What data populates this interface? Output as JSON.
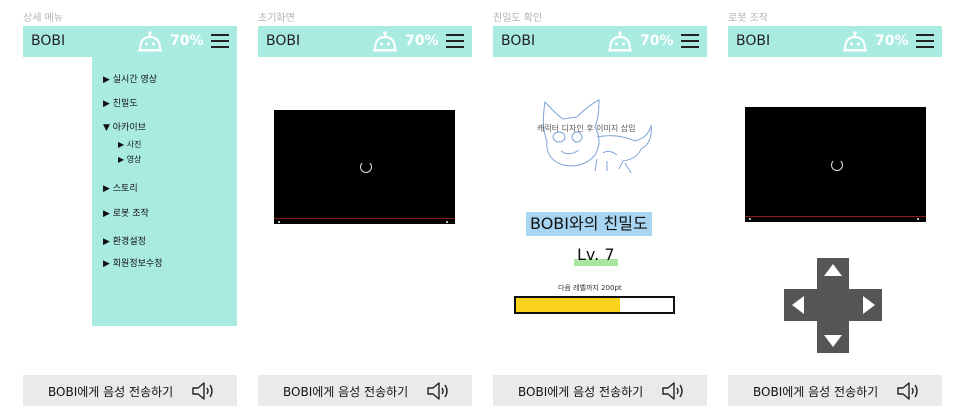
{
  "screens": [
    {
      "caption": "상세 메뉴"
    },
    {
      "caption": "초기화면"
    },
    {
      "caption": "친밀도 확인"
    },
    {
      "caption": "로봇 조작"
    }
  ],
  "header": {
    "brand": "BOBI",
    "battery": "70%"
  },
  "footer": {
    "label": "BOBI에게 음성 전송하기"
  },
  "menu": {
    "items": [
      "▶ 실시간 영상",
      "▶ 친밀도",
      "▼ 아카이브",
      "▶ 스토리",
      "▶ 로봇 조작",
      "▶ 환경설정",
      "▶ 회원정보수정"
    ],
    "sub_items": [
      "▶ 사진",
      "▶ 영상"
    ]
  },
  "affinity": {
    "character_caption": "캐릭터 디자인 후 이미지 삽입",
    "title": "BOBI와의 친밀도",
    "level": "Lv. 7",
    "next_level_text": "다음 레벨까지 200pt",
    "progress": 0.66
  },
  "colors": {
    "header": "#a9ebe0",
    "menu_panel": "#a9ebe0",
    "footer": "#eaeaea",
    "xp_fill": "#f8d21b",
    "title_highlight": "#a7d5f2",
    "level_highlight": "#a9e6a0"
  },
  "icons": [
    "robot-icon",
    "hamburger-icon",
    "speaker-icon",
    "loading-spinner-icon",
    "dpad-up-icon",
    "dpad-down-icon",
    "dpad-left-icon",
    "dpad-right-icon"
  ]
}
